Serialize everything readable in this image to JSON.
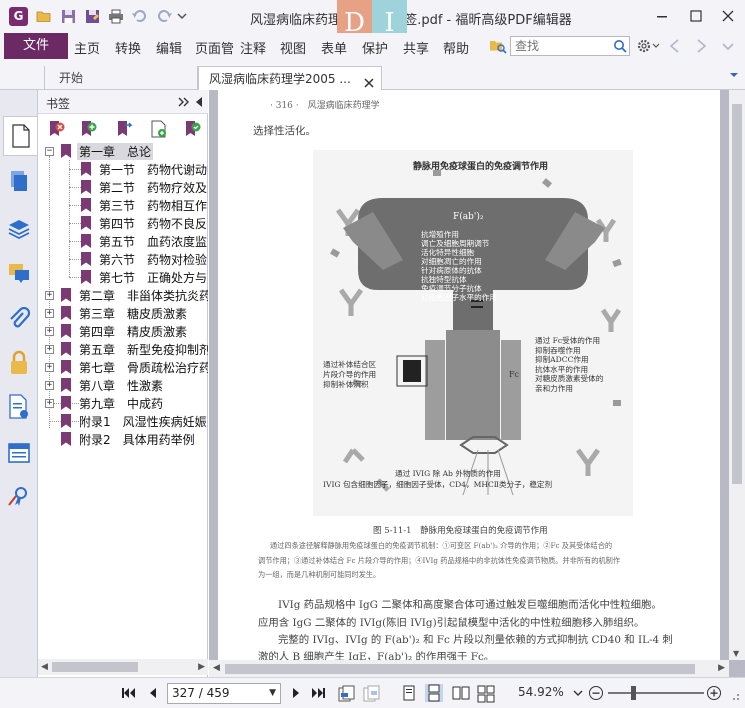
{
  "titlebar": {
    "app_logo": "G",
    "title": "风湿病临床药理学2005 书签.pdf - 福昕高级PDF编辑器",
    "watermark_left": "D",
    "watermark_right": "I",
    "icons": [
      "open-folder-icon",
      "save-icon",
      "save-as-icon",
      "print-icon",
      "undo-icon",
      "redo-icon",
      "customize-dropdown-icon",
      "minimize-icon",
      "maximize-icon",
      "close-icon"
    ]
  },
  "menubar": {
    "file": "文件",
    "items": [
      "主页",
      "转换",
      "编辑",
      "页面管",
      "注释",
      "视图",
      "表单",
      "保护",
      "共享",
      "帮助"
    ],
    "search_placeholder": "查找"
  },
  "tabs": {
    "home": "开始",
    "document": "风湿病临床药理学2005 ..."
  },
  "bookmarks": {
    "title": "书签",
    "tree": [
      {
        "label": "第一章　总论",
        "level": 0,
        "toggle": "−",
        "selected": true
      },
      {
        "label": "第一节　药物代谢动",
        "level": 1
      },
      {
        "label": "第二节　药物疗效及",
        "level": 1
      },
      {
        "label": "第三节　药物相互作",
        "level": 1
      },
      {
        "label": "第四节　药物不良反",
        "level": 1
      },
      {
        "label": "第五节　血药浓度监",
        "level": 1
      },
      {
        "label": "第六节　药物对检验",
        "level": 1
      },
      {
        "label": "第七节　正确处方与",
        "level": 1
      },
      {
        "label": "第二章　非甾体类抗炎药",
        "level": 0,
        "toggle": "+"
      },
      {
        "label": "第三章　糖皮质激素",
        "level": 0,
        "toggle": "+"
      },
      {
        "label": "第四章　精皮质激素",
        "level": 0,
        "toggle": "+"
      },
      {
        "label": "第五章　新型免疫抑制剂",
        "level": 0,
        "toggle": "+"
      },
      {
        "label": "第七章　骨质疏松治疗药",
        "level": 0,
        "toggle": "+"
      },
      {
        "label": "第八章　性激素",
        "level": 0,
        "toggle": "+"
      },
      {
        "label": "第九章　中成药",
        "level": 0,
        "toggle": "+"
      },
      {
        "label": "附录1　风湿性疾病妊娠",
        "level": 0
      },
      {
        "label": "附录2　具体用药举例",
        "level": 0
      }
    ]
  },
  "document": {
    "running_header": "· 316 ·　风湿病临床药理学",
    "intro_line": "选择性活化。",
    "figure": {
      "title": "静脉用免疫球蛋白的免疫调节作用",
      "fab_label": "F(ab')₂",
      "fab_list": [
        "抗增殖作用",
        "调亡及细胞周期调节",
        "活化特异性细胞",
        "对细胞凋亡的作用",
        "针对病原体的抗体",
        "抗独特型抗体",
        "免疫调节分子抗体",
        "对细胞因子水平的作用"
      ],
      "left_text": [
        "通过补体结合区",
        "片段介导的作用",
        "抑制补体沉积"
      ],
      "fc_label": "Fc",
      "right_text": [
        "通过 Fc受体的作用",
        "抑制吞噬作用",
        "抑制ADCC作用",
        "抗体水平的作用",
        "对糖皮质激素受体的",
        "亲和力作用"
      ],
      "bottom_text": [
        "通过 IVIG 除 Ab 外物质的作用",
        "IVIG 包含细胞因子，细胞因子受体，CD4，MHCⅡ类分子，稳定剂"
      ]
    },
    "caption": "图 5-11-1　静脉用免疫球蛋白的免疫调节作用",
    "caption_notes": [
      "通过四条途径解释静脉用免疫球蛋白的免疫调节机制：①可变区 F(ab')₂ 介导的作用；②Fc 及其受体结合的",
      "调节作用；③通过补体结合 Fc 片段介导的作用；④IVIg 药品规格中的非抗体性免疫调节物质。并非所有的机制作",
      "为一组，而是几种机制可能同时发生。"
    ],
    "body_lines": [
      "IVIg 药品规格中 IgG 二聚体和高度聚合体可通过触发巨噬细胞而活化中性粒细胞。",
      "应用含 IgG 二聚体的 IVIg(陈旧 IVIg)引起鼠模型中活化的中性粒细胞移入肺组织。",
      "完整的 IVIg、IVIg 的 F(ab')₂ 和 Fc 片段以剂量依赖的方式抑制抗 CD40 和 IL-4 刺",
      "激的人 B 细胞产生 IgE，F(ab')₂ 的作用强于 Fc。"
    ]
  },
  "statusbar": {
    "page_indicator": "327 / 459",
    "zoom": "54.92%"
  },
  "colors": {
    "brand_purple": "#6b2a63",
    "bookmark_flag": "#7b3a73",
    "rail_blue": "#2f6fc9",
    "doc_background": "#b9b9c6"
  }
}
